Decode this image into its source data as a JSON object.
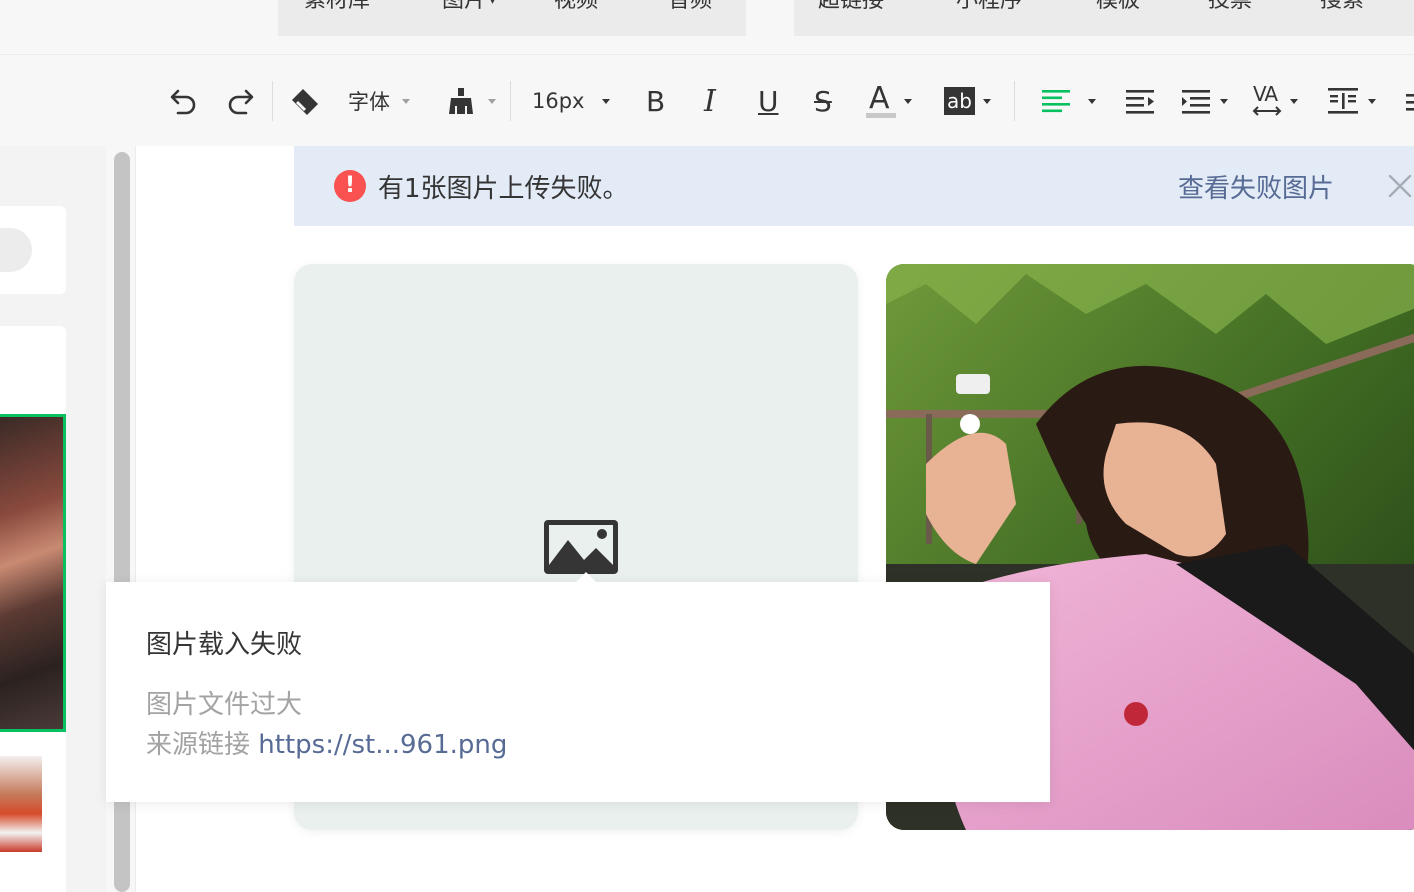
{
  "insert_menu": {
    "group1": [
      {
        "label": "素材库"
      },
      {
        "label": "图片",
        "has_dropdown": true
      },
      {
        "label": "视频"
      },
      {
        "label": "音频"
      }
    ],
    "group2": [
      {
        "label": "超链接"
      },
      {
        "label": "小程序"
      },
      {
        "label": "模板"
      },
      {
        "label": "投票"
      },
      {
        "label": "搜索"
      }
    ]
  },
  "toolbar": {
    "font_family_label": "字体",
    "font_size_label": "16px",
    "bold_glyph": "B",
    "italic_glyph": "I",
    "underline_glyph": "U",
    "strike_glyph": "S",
    "font_color_glyph": "A",
    "highlight_glyph": "ab",
    "letter_spacing_glyph": "VA",
    "accent_color": "#07c160"
  },
  "banner": {
    "icon_glyph": "!",
    "message": "有1张图片上传失败。",
    "link_label": "查看失败图片",
    "background": "#e3ebf6",
    "link_color": "#576b95"
  },
  "tooltip": {
    "title": "图片载入失败",
    "reason": "图片文件过大",
    "source_label": "来源链接",
    "source_url": "https://st...961.png"
  }
}
